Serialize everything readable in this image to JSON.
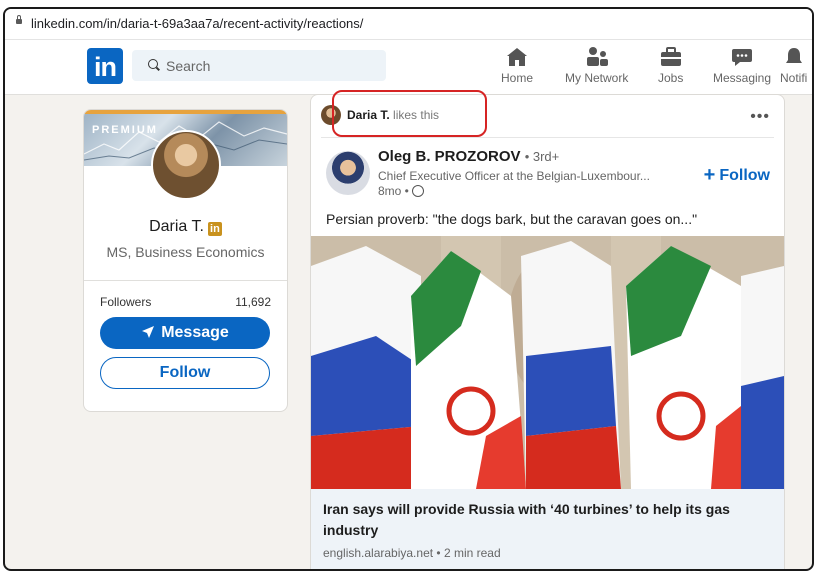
{
  "browser": {
    "url": "linkedin.com/in/daria-t-69a3aa7a/recent-activity/reactions/"
  },
  "nav": {
    "logo": "in",
    "search_placeholder": "Search",
    "items": [
      {
        "label": "Home",
        "icon": "home-icon"
      },
      {
        "label": "My Network",
        "icon": "network-icon"
      },
      {
        "label": "Jobs",
        "icon": "briefcase-icon"
      },
      {
        "label": "Messaging",
        "icon": "messaging-icon"
      },
      {
        "label": "Notifi",
        "icon": "bell-icon"
      }
    ]
  },
  "profile": {
    "premium_label": "PREMIUM",
    "name": "Daria T.",
    "badge": "in",
    "headline": "MS, Business Economics",
    "followers_label": "Followers",
    "followers_count": "11,692",
    "message_label": "Message",
    "follow_label": "Follow"
  },
  "post": {
    "actor_name": "Daria T.",
    "actor_action": "likes this",
    "more": "•••",
    "author": {
      "name": "Oleg B. PROZOROV",
      "degree": "• 3rd+",
      "title": "Chief Executive Officer at the Belgian-Luxembour...",
      "time": "8mo •"
    },
    "follow_label": "Follow",
    "follow_plus": "+",
    "text": "Persian proverb: \"the dogs bark, but the caravan goes on...\"",
    "link": {
      "title": "Iran says will provide Russia with ‘40 turbines’ to help its gas industry",
      "source": "english.alarabiya.net • 2 min read"
    }
  },
  "colors": {
    "brand": "#0a66c2",
    "highlight": "#d62424",
    "premium": "#c9921e"
  }
}
